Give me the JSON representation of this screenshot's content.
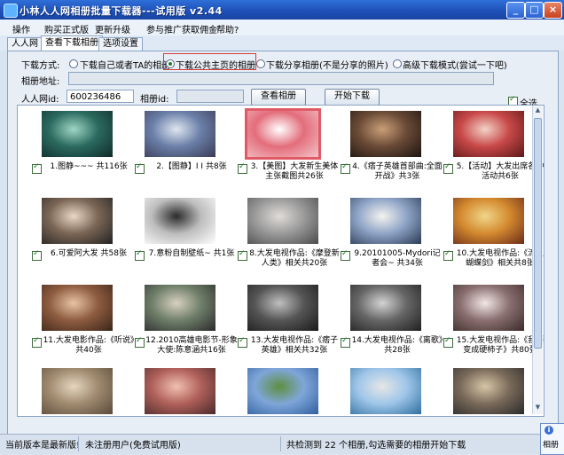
{
  "window": {
    "title": "小林人人网相册批量下载器---试用版   v2.44",
    "min": "_",
    "max": "□",
    "close": "×"
  },
  "menu": {
    "items": [
      "操作",
      "购买正式版",
      "更新升级",
      "参与推广获取佣金",
      "帮助?"
    ]
  },
  "tabs": [
    "人人网",
    "查看下载相册",
    "选项设置"
  ],
  "mode": {
    "label": "下载方式:",
    "options": [
      "下载自己或者TA的相册",
      "下载公共主页的相册",
      "下载分享相册(不是分享的照片)",
      "高级下载模式(尝试一下吧)"
    ],
    "selected_index": 1
  },
  "album_url": {
    "label": "相册地址:",
    "value": ""
  },
  "renren_id": {
    "label": "人人网id:",
    "value": "600236486"
  },
  "album_id": {
    "label": "相册id:",
    "value": ""
  },
  "buttons": {
    "view": "查看相册",
    "start": "开始下载"
  },
  "select_all": "全选",
  "albums": [
    {
      "caption": "1.图静~~~ 共116张",
      "colors": [
        "#0f2a2a",
        "#2b6a5f",
        "#9fd6c4"
      ]
    },
    {
      "caption": "2.【图静】I I 共8张",
      "colors": [
        "#3b3b55",
        "#6a7fa8",
        "#dfe6f0"
      ]
    },
    {
      "caption": "3.【美图】大发新生美体主张截图共26张",
      "colors": [
        "#f3c4c9",
        "#e36d7b",
        "#ffffff"
      ]
    },
    {
      "caption": "4.《痞子英雄首部曲:全面开战》共3张",
      "colors": [
        "#1c1410",
        "#6a4a36",
        "#c99f78"
      ]
    },
    {
      "caption": "5.【活动】大发出席各种活动共6张",
      "colors": [
        "#5a1818",
        "#c84848",
        "#f3d2c7"
      ]
    },
    {
      "caption": "6.可爱阿大发 共58张",
      "colors": [
        "#222222",
        "#7b6655",
        "#e9d8c6"
      ]
    },
    {
      "caption": "7.意粉自制壁纸~ 共1张",
      "colors": [
        "#ffffff",
        "#bdbdbd",
        "#2b2b2b"
      ]
    },
    {
      "caption": "8.大发电视作品:《摩登新人类》相关共20张",
      "colors": [
        "#4b4b4b",
        "#9a9a9a",
        "#e0dcd8"
      ]
    },
    {
      "caption": "9.20101005-Mydori记者会~ 共34张",
      "colors": [
        "#2a3a55",
        "#8fa5c7",
        "#f5f3ef"
      ]
    },
    {
      "caption": "10.大发电视作品:《流星蝴蝶剑》相关共8张",
      "colors": [
        "#6a2a1a",
        "#d48a2f",
        "#f0d68a"
      ]
    },
    {
      "caption": "11.大发电影作品:《听说》共40张",
      "colors": [
        "#3a2418",
        "#8e5c40",
        "#e8c3a4"
      ]
    },
    {
      "caption": "12.2010高雄电影节-形象大使:陈意涵共16张",
      "colors": [
        "#2a2a2a",
        "#6f7f6a",
        "#d8d0c0"
      ]
    },
    {
      "caption": "13.大发电视作品:《痞子英雄》相关共32张",
      "colors": [
        "#1a1a1a",
        "#555555",
        "#bfbfbf"
      ]
    },
    {
      "caption": "14.大发电视作品:《离歌》共28张",
      "colors": [
        "#1f1f1f",
        "#666666",
        "#d3d3d3"
      ]
    },
    {
      "caption": "15.大发电视作品:《我要变成硬柿子》共80张",
      "colors": [
        "#3a2a2a",
        "#8a6f6f",
        "#f2e6e6"
      ]
    },
    {
      "caption": "",
      "colors": [
        "#5a4a3a",
        "#a08a70",
        "#e6d6c0"
      ]
    },
    {
      "caption": "",
      "colors": [
        "#4a2a2a",
        "#b0605a",
        "#f0c0b0"
      ]
    },
    {
      "caption": "",
      "colors": [
        "#2f5f9f",
        "#7fa6d9",
        "#5f8f3f"
      ]
    },
    {
      "caption": "",
      "colors": [
        "#2f6f9f",
        "#9fc6e9",
        "#e6e6e6"
      ]
    },
    {
      "caption": "",
      "colors": [
        "#2a2a2a",
        "#7a6a5a",
        "#d6c6a6"
      ]
    }
  ],
  "status": {
    "version": "当前版本是最新版!",
    "user": "未注册用户(免费试用版)",
    "message": "共检测到 22 个相册,勾选需要的相册开始下载"
  },
  "popup": {
    "icon": "i",
    "text": "相册"
  }
}
